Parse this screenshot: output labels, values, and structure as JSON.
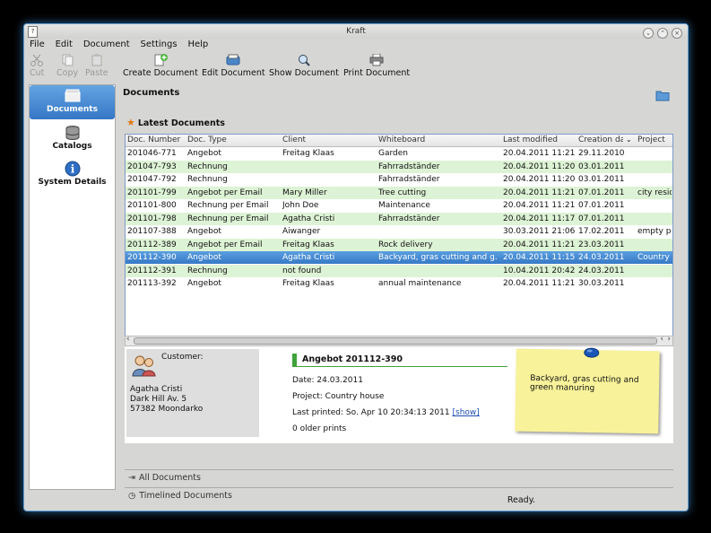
{
  "window": {
    "title": "Kraft"
  },
  "menu": [
    "File",
    "Edit",
    "Document",
    "Settings",
    "Help"
  ],
  "toolbar": {
    "cut": "Cut",
    "copy": "Copy",
    "paste": "Paste",
    "create": "Create Document",
    "edit": "Edit Document",
    "show": "Show Document",
    "print": "Print Document"
  },
  "sidebar": {
    "documents": "Documents",
    "catalogs": "Catalogs",
    "system": "System Details"
  },
  "panel": {
    "title": "Documents",
    "latest": "Latest Documents"
  },
  "table": {
    "headers": [
      "Doc. Number",
      "Doc. Type",
      "Client",
      "Whiteboard",
      "Last modified",
      "Creation da",
      "Project"
    ],
    "rows": [
      [
        "201046-771",
        "Angebot",
        "Freitag Klaas",
        "Garden",
        "20.04.2011 11:21",
        "29.11.2010",
        ""
      ],
      [
        "201047-793",
        "Rechnung",
        "",
        "Fahrradständer",
        "20.04.2011 11:20",
        "03.01.2011",
        ""
      ],
      [
        "201047-792",
        "Rechnung",
        "",
        "Fahrradständer",
        "20.04.2011 11:20",
        "03.01.2011",
        ""
      ],
      [
        "201101-799",
        "Angebot per Email",
        "Mary Miller",
        "Tree cutting",
        "20.04.2011 11:21",
        "07.01.2011",
        "city resid"
      ],
      [
        "201101-800",
        "Rechnung per Email",
        "John Doe",
        "Maintenance",
        "20.04.2011 11:21",
        "07.01.2011",
        ""
      ],
      [
        "201101-798",
        "Rechnung per Email",
        "Agatha Cristi",
        " Fahrradständer",
        "20.04.2011 11:17",
        "07.01.2011",
        ""
      ],
      [
        "201107-388",
        "Angebot",
        "Aiwanger",
        "",
        "30.03.2011 21:06",
        "17.02.2011",
        "empty pr"
      ],
      [
        "201112-389",
        "Angebot per Email",
        "Freitag Klaas",
        "Rock delivery",
        "20.04.2011 11:21",
        "23.03.2011",
        ""
      ],
      [
        "201112-390",
        "Angebot",
        "Agatha Cristi",
        "Backyard, gras cutting and g...",
        "20.04.2011 11:15",
        "24.03.2011",
        "Country h"
      ],
      [
        "201112-391",
        "Rechnung",
        "not found",
        "",
        "10.04.2011 20:42",
        "24.03.2011",
        ""
      ],
      [
        "201113-392",
        "Angebot",
        "Freitag Klaas",
        "annual maintenance",
        "20.04.2011 11:21",
        "30.03.2011",
        ""
      ]
    ],
    "selected_index": 8
  },
  "customer": {
    "label": "Customer:",
    "name": "Agatha Cristi",
    "street": "Dark Hill Av. 5",
    "city": "57382 Moondarko"
  },
  "document": {
    "title": "Angebot 201112-390",
    "date": "Date: 24.03.2011",
    "project": "Project: Country house",
    "last_printed": "Last printed: So. Apr 10 20:34:13 2011",
    "show_link": "[show]",
    "older_prints": "0 older prints"
  },
  "note": "Backyard, gras cutting and green manuring",
  "sections": {
    "all": "All Documents",
    "timelined": "Timelined Documents"
  },
  "status": "Ready.",
  "colors": {
    "selection": "#3679c6",
    "alt_row": "#ddf3d5",
    "accent_bar": "#3ea23a",
    "note": "#f8f29a"
  }
}
